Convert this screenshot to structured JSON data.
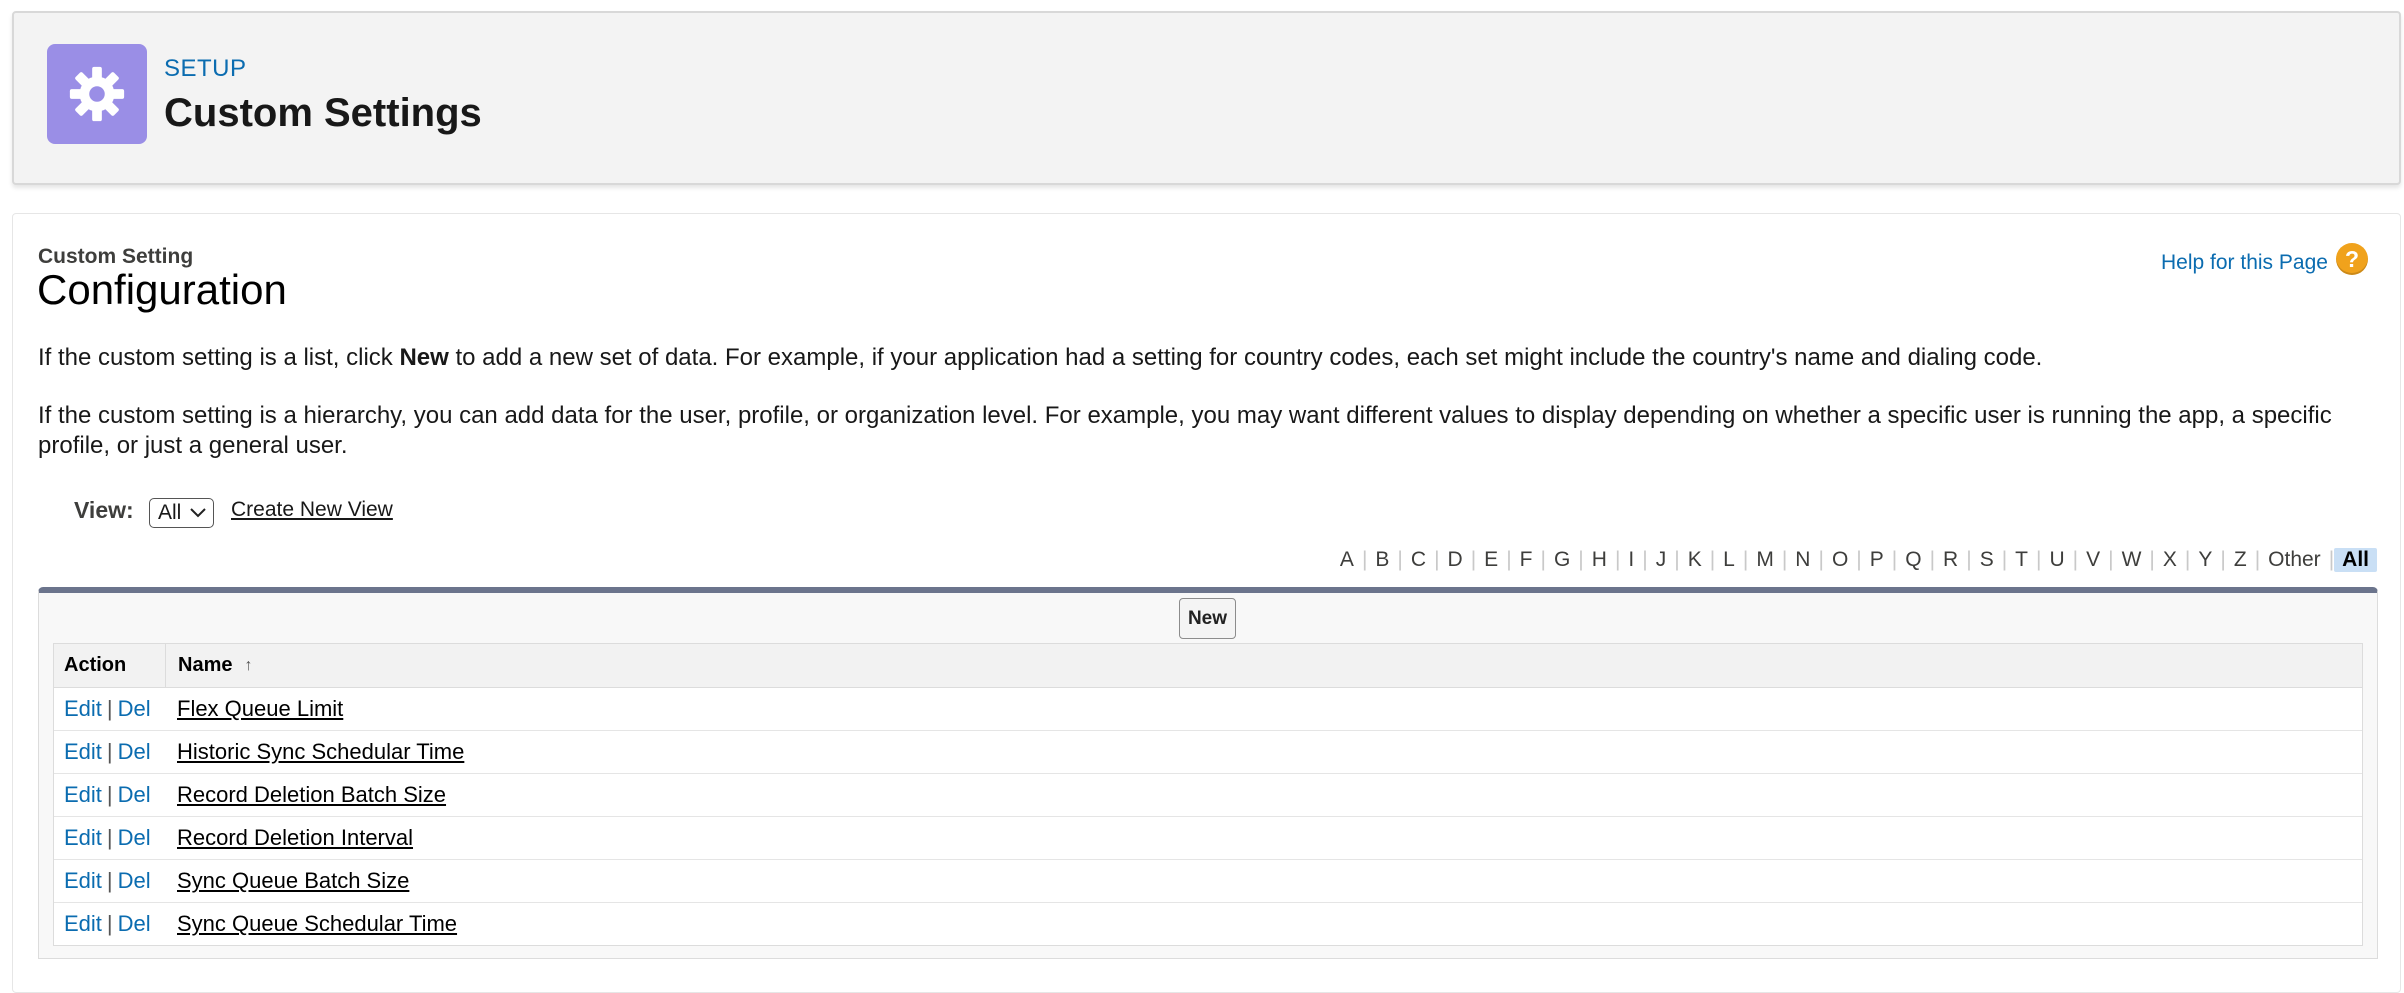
{
  "header": {
    "breadcrumb": "SETUP",
    "title": "Custom Settings",
    "icon": "gear-icon",
    "icon_color": "#9a8ee6"
  },
  "section": {
    "subtitle": "Custom Setting",
    "title": "Configuration",
    "help_link": "Help for this Page",
    "help_icon_glyph": "?"
  },
  "description": {
    "p1_before": "If the custom setting is a list, click ",
    "p1_bold": "New",
    "p1_after": " to add a new set of data. For example, if your application had a setting for country codes, each set might include the country's name and dialing code.",
    "p2": "If the custom setting is a hierarchy, you can add data for the user, profile, or organization level. For example, you may want different values to display depending on whether a specific user is running the app, a specific profile, or just a general user."
  },
  "view": {
    "label": "View:",
    "selected": "All",
    "create_link": "Create New View"
  },
  "alpha_filter": {
    "letters": [
      "A",
      "B",
      "C",
      "D",
      "E",
      "F",
      "G",
      "H",
      "I",
      "J",
      "K",
      "L",
      "M",
      "N",
      "O",
      "P",
      "Q",
      "R",
      "S",
      "T",
      "U",
      "V",
      "W",
      "X",
      "Y",
      "Z",
      "Other"
    ],
    "active": "All"
  },
  "list": {
    "new_button": "New",
    "columns": {
      "action": "Action",
      "name": "Name"
    },
    "edit_label": "Edit",
    "separator": "|",
    "delete_label": "Del",
    "rows": [
      {
        "name": "Flex Queue Limit"
      },
      {
        "name": "Historic Sync Schedular Time"
      },
      {
        "name": "Record Deletion Batch Size"
      },
      {
        "name": "Record Deletion Interval"
      },
      {
        "name": "Sync Queue Batch Size"
      },
      {
        "name": "Sync Queue Schedular Time"
      }
    ]
  },
  "colors": {
    "link": "#0b6cb0",
    "help_icon": "#f0a21c",
    "list_accent": "#6b748c"
  }
}
